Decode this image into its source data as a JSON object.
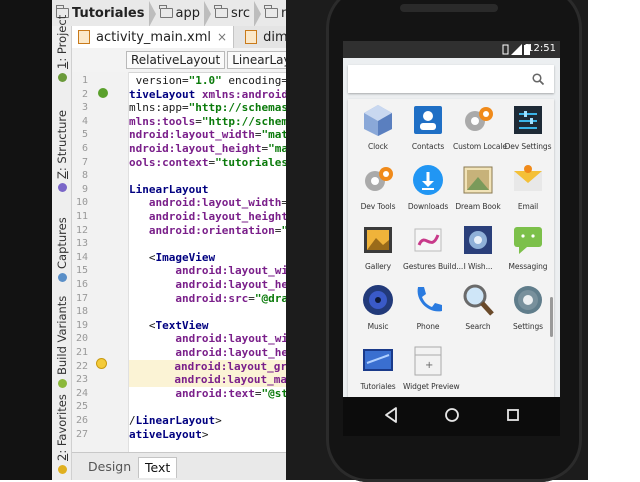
{
  "ide": {
    "breadcrumbs": [
      "Tutoriales",
      "app",
      "src",
      "ma"
    ],
    "vertical_tabs": [
      {
        "num": "1",
        "label": "Project"
      },
      {
        "num": "Z",
        "label": "Structure"
      },
      {
        "num": "",
        "label": "Captures"
      },
      {
        "num": "",
        "label": "Build Variants"
      },
      {
        "num": "2",
        "label": "Favorites"
      }
    ],
    "editor_tabs": [
      {
        "label": "activity_main.xml",
        "close": "×"
      },
      {
        "label": "dimen"
      }
    ],
    "xml_breadcrumbs": [
      "RelativeLayout",
      "LinearLay"
    ],
    "line_numbers": [
      "1",
      "2",
      "3",
      "4",
      "5",
      "6",
      "7",
      "8",
      "9",
      "10",
      "11",
      "12",
      "13",
      "14",
      "15",
      "16",
      "17",
      "18",
      "19",
      "20",
      "21",
      "22",
      "23",
      "24",
      "25",
      "26",
      "27"
    ],
    "code_lines": [
      [
        {
          "t": "plain",
          "s": " version="
        },
        {
          "t": "str",
          "s": "\"1.0\""
        },
        {
          "t": "plain",
          "s": " encoding="
        },
        {
          "t": "str",
          "s": "\""
        }
      ],
      [
        {
          "t": "tag",
          "s": "tiveLayout "
        },
        {
          "t": "attr",
          "s": "xmlns:android"
        },
        {
          "t": "plain",
          "s": "="
        }
      ],
      [
        {
          "t": "plain",
          "s": "mlns:app="
        },
        {
          "t": "str",
          "s": "\"http://schemas."
        }
      ],
      [
        {
          "t": "attr",
          "s": "mlns:tools"
        },
        {
          "t": "plain",
          "s": "="
        },
        {
          "t": "str",
          "s": "\"http://schema"
        }
      ],
      [
        {
          "t": "attr",
          "s": "ndroid:layout_width"
        },
        {
          "t": "plain",
          "s": "="
        },
        {
          "t": "str",
          "s": "\"matc"
        }
      ],
      [
        {
          "t": "attr",
          "s": "ndroid:layout_height"
        },
        {
          "t": "plain",
          "s": "="
        },
        {
          "t": "str",
          "s": "\"mat"
        }
      ],
      [
        {
          "t": "attr",
          "s": "ools:context"
        },
        {
          "t": "plain",
          "s": "="
        },
        {
          "t": "str",
          "s": "\"tutoriales."
        }
      ],
      [],
      [
        {
          "t": "tag",
          "s": "LinearLayout"
        }
      ],
      [
        {
          "t": "attr",
          "s": "   android:layout_width"
        },
        {
          "t": "plain",
          "s": "="
        },
        {
          "t": "str",
          "s": "\""
        }
      ],
      [
        {
          "t": "attr",
          "s": "   android:layout_height"
        },
        {
          "t": "plain",
          "s": "="
        },
        {
          "t": "str",
          "s": "\""
        }
      ],
      [
        {
          "t": "attr",
          "s": "   android:orientation"
        },
        {
          "t": "plain",
          "s": "="
        },
        {
          "t": "str",
          "s": "\"h"
        }
      ],
      [],
      [
        {
          "t": "plain",
          "s": "   <"
        },
        {
          "t": "tag",
          "s": "ImageView"
        }
      ],
      [
        {
          "t": "attr",
          "s": "       android:layout_wid"
        }
      ],
      [
        {
          "t": "attr",
          "s": "       android:layout_hei"
        }
      ],
      [
        {
          "t": "attr",
          "s": "       android:src"
        },
        {
          "t": "plain",
          "s": "="
        },
        {
          "t": "str",
          "s": "\"@draw"
        }
      ],
      [],
      [
        {
          "t": "plain",
          "s": "   <"
        },
        {
          "t": "tag",
          "s": "TextView"
        }
      ],
      [
        {
          "t": "attr",
          "s": "       android:layout_wid"
        }
      ],
      [
        {
          "t": "attr",
          "s": "       android:layout_hei"
        }
      ],
      [
        {
          "t": "attr",
          "s": "       android:layout_gra"
        }
      ],
      [
        {
          "t": "attr",
          "s": "       android:layout_mar"
        }
      ],
      [
        {
          "t": "attr",
          "s": "       android:text"
        },
        {
          "t": "plain",
          "s": "="
        },
        {
          "t": "str",
          "s": "\"@str"
        }
      ],
      [],
      [
        {
          "t": "plain",
          "s": "/"
        },
        {
          "t": "tag",
          "s": "LinearLayout"
        },
        {
          "t": "plain",
          "s": ">"
        }
      ],
      [
        {
          "t": "tag",
          "s": "ativeLayout"
        },
        {
          "t": "plain",
          "s": ">"
        }
      ]
    ],
    "highlight_lines": [
      21,
      22
    ],
    "bottom_tabs": [
      "Design",
      "Text"
    ],
    "active_bottom_tab": "Text"
  },
  "phone": {
    "status_time": "12:51",
    "apps": [
      {
        "label": "Clock",
        "icon": "clock-icon"
      },
      {
        "label": "Contacts",
        "icon": "contacts-icon"
      },
      {
        "label": "Custom Locale",
        "icon": "custom-locale-icon"
      },
      {
        "label": "Dev Settings",
        "icon": "dev-settings-icon"
      },
      {
        "label": "Dev Tools",
        "icon": "dev-tools-icon"
      },
      {
        "label": "Downloads",
        "icon": "downloads-icon"
      },
      {
        "label": "Dream Book",
        "icon": "dream-book-icon"
      },
      {
        "label": "Email",
        "icon": "email-icon"
      },
      {
        "label": "Gallery",
        "icon": "gallery-icon"
      },
      {
        "label": "Gestures Build...",
        "icon": "gestures-builder-icon"
      },
      {
        "label": "I Wish...",
        "icon": "i-wish-icon"
      },
      {
        "label": "Messaging",
        "icon": "messaging-icon"
      },
      {
        "label": "Music",
        "icon": "music-icon"
      },
      {
        "label": "Phone",
        "icon": "phone-icon"
      },
      {
        "label": "Search",
        "icon": "search-app-icon"
      },
      {
        "label": "Settings",
        "icon": "settings-icon"
      },
      {
        "label": "Tutoriales",
        "icon": "tutoriales-icon"
      },
      {
        "label": "Widget Preview",
        "icon": "widget-preview-icon"
      }
    ]
  },
  "colors": {
    "ide_tag": "#000080",
    "ide_attr": "#7a1f8a",
    "ide_string": "#0a7a0a",
    "phone_body": "#141414",
    "status_bar": "#303030"
  }
}
